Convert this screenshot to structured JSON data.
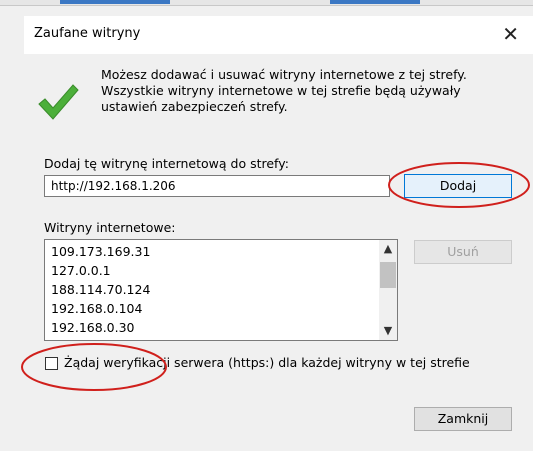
{
  "dialog": {
    "title": "Zaufane witryny",
    "close_symbol": "✕"
  },
  "info": {
    "icon": "checkmark-icon",
    "line1": "Możesz dodawać i usuwać witryny internetowe z tej strefy.",
    "line2": "Wszystkie witryny internetowe w tej strefie będą używały",
    "line3": "ustawień zabezpieczeń strefy."
  },
  "add": {
    "label": "Dodaj tę witrynę internetową do strefy:",
    "value": "http://192.168.1.206",
    "button": "Dodaj"
  },
  "sites": {
    "label": "Witryny internetowe:",
    "items": [
      "109.173.169.31",
      "127.0.0.1",
      "188.114.70.124",
      "192.168.0.104",
      "192.168.0.30"
    ],
    "remove_button": "Usuń"
  },
  "https": {
    "label": "Żądaj weryfikacji serwera (https:) dla każdej witryny w tej strefie",
    "checked": false
  },
  "footer": {
    "close_button": "Zamknij"
  },
  "colors": {
    "check_green": "#4caf3a",
    "annotation_red": "#d0201c",
    "focus_blue": "#0078d7"
  }
}
